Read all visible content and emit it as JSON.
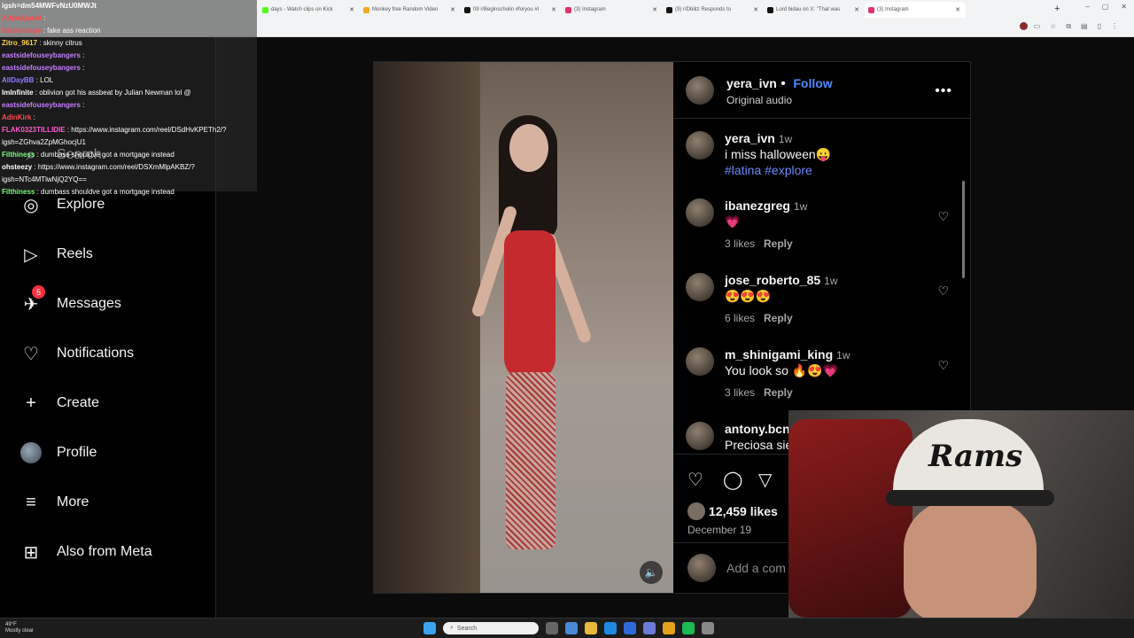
{
  "browser": {
    "tabs": [
      {
        "label": "days - Watch clips on Kick",
        "color": "#53fc18"
      },
      {
        "label": "Monkey free Random Video",
        "color": "#f5a623"
      },
      {
        "label": "09 r/Beginscholin #foryou #l",
        "color": "#111111"
      },
      {
        "label": "(3) Instagram",
        "color": "#e1306c"
      },
      {
        "label": "(9) r/Dblitz Responds to",
        "color": "#111111"
      },
      {
        "label": "Lord bidau on X: \"That was",
        "color": "#111111"
      },
      {
        "label": "(3) Instagram",
        "color": "#e1306c"
      }
    ],
    "new_tab": "+",
    "window_controls": [
      "–",
      "▢",
      "✕"
    ]
  },
  "chat": {
    "messages": [
      {
        "user": "igsh=dm54MWFvNzU0MWJt",
        "text": "",
        "color": "#ffffff"
      },
      {
        "user": "AdinsQueef",
        "text": ":",
        "color": "#ff4b4b"
      },
      {
        "user": "Blackanege",
        "text": ": fake ass reaction",
        "color": "#ff4b4b"
      },
      {
        "user": "Zitro_9617",
        "text": ": skinny citrus",
        "color": "#ffd54a"
      },
      {
        "user": "eastsidefouseybangers",
        "text": ":",
        "color": "#c77dff"
      },
      {
        "user": "eastsidefouseybangers",
        "text": ":",
        "color": "#c77dff"
      },
      {
        "user": "AllDayBB",
        "text": ": LOL",
        "color": "#8f7dff"
      },
      {
        "user": "ImInfinite",
        "text": ": oblivion got his assbeat by Julian Newman lol @",
        "color": "#ffffff"
      },
      {
        "user": "eastsidefouseybangers",
        "text": ":",
        "color": "#c77dff"
      },
      {
        "user": "AdinKirk",
        "text": ":",
        "color": "#ff4b4b"
      },
      {
        "user": "FLAK0323TILLIDIE",
        "text": ": https://www.instagram.com/reel/DSdHvKPETh2/?",
        "color": "#ff5ad1"
      },
      {
        "user": "",
        "text": "igsh=ZGhva2ZpMGhocjU1",
        "color": "#ffffff"
      },
      {
        "user": "Filthiness",
        "text": ": dumbass shouldve got a mortgage instead",
        "color": "#7dff7d"
      },
      {
        "user": "ohsteezy",
        "text": ": https://www.instagram.com/reel/DSXmMlpAKBZ/?",
        "color": "#ffffff"
      },
      {
        "user": "",
        "text": "igsh=NTc4MTlwNjQ2YQ==",
        "color": "#ffffff"
      },
      {
        "user": "Filthiness",
        "text": ": dumbass shouldve got a mortgage instead",
        "color": "#7dff7d"
      }
    ]
  },
  "sidebar": {
    "items": [
      {
        "label": "Search",
        "icon": "search-icon",
        "glyph": "⌕"
      },
      {
        "label": "Explore",
        "icon": "compass-icon",
        "glyph": "◎"
      },
      {
        "label": "Reels",
        "icon": "reels-icon",
        "glyph": "▷"
      },
      {
        "label": "Messages",
        "icon": "messenger-icon",
        "glyph": "✈",
        "badge": "5"
      },
      {
        "label": "Notifications",
        "icon": "heart-icon",
        "glyph": "♡"
      },
      {
        "label": "Create",
        "icon": "plus-icon",
        "glyph": "+"
      },
      {
        "label": "Profile",
        "icon": "avatar-icon",
        "glyph": ""
      },
      {
        "label": "More",
        "icon": "menu-icon",
        "glyph": "≡"
      },
      {
        "label": "Also from Meta",
        "icon": "meta-icon",
        "glyph": "⊞"
      }
    ]
  },
  "post": {
    "author": "yera_ivn",
    "follow_label": "Follow",
    "audio": "Original audio",
    "caption_time": "1w",
    "caption_text": "i miss halloween😛",
    "hashtags": "#latina #explore",
    "comments": [
      {
        "user": "ibanezgreg",
        "time": "1w",
        "text": "💗",
        "likes": "3 likes",
        "reply": "Reply"
      },
      {
        "user": "jose_roberto_85",
        "time": "1w",
        "text": "😍😍😍",
        "likes": "6 likes",
        "reply": "Reply"
      },
      {
        "user": "m_shinigami_king",
        "time": "1w",
        "text": "You look so 🔥😍💗",
        "likes": "3 likes",
        "reply": "Reply"
      },
      {
        "user": "antony.bcn",
        "time": "",
        "text": "Preciosa sie",
        "likes": "",
        "reply": ""
      }
    ],
    "like_count": "12,459 likes",
    "date": "December 19",
    "add_comment_placeholder": "Add a com"
  },
  "webcam": {
    "cap_text": "Rams"
  },
  "taskbar": {
    "weather_temp": "49°F",
    "weather_desc": "Mostly clear",
    "search_placeholder": "Search"
  },
  "colors": {
    "accent_blue": "#4a8bff",
    "badge_red": "#ff3040",
    "background": "#000000"
  }
}
